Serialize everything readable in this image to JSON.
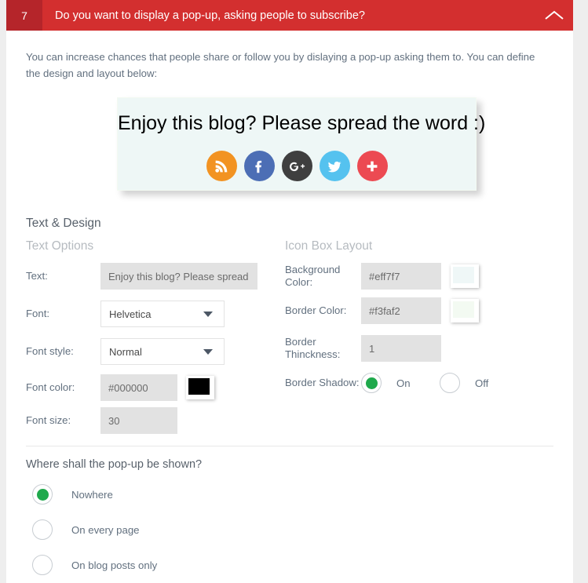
{
  "panel": {
    "number": "7",
    "title": "Do you want to display a pop-up, asking people to subscribe?",
    "collapse_icon": "chevron-up-icon",
    "header_bg": "#d32f2f",
    "number_bg": "#b5252a",
    "intro": "You can increase chances that people share or follow you by dislaying a pop-up asking them to. You can define the design and layout below:"
  },
  "preview": {
    "text": "Enjoy this blog? Please spread the word :)",
    "background_color": "#eff7f7",
    "border_color": "#f3faf2",
    "font_color": "#000000",
    "font_size": "30",
    "icons": [
      {
        "name": "rss-icon",
        "color": "#f29322"
      },
      {
        "name": "facebook-icon",
        "color": "#4c6eb5"
      },
      {
        "name": "google-plus-icon",
        "color": "#3f3f3f"
      },
      {
        "name": "twitter-icon",
        "color": "#55c2ef"
      },
      {
        "name": "share-plus-icon",
        "color": "#ec4a52"
      }
    ]
  },
  "design": {
    "section_title": "Text & Design",
    "text_options": {
      "title": "Text Options",
      "text_label": "Text:",
      "text_value": "Enjoy this blog? Please spread the word :)",
      "font_label": "Font:",
      "font_value": "Helvetica",
      "font_style_label": "Font style:",
      "font_style_value": "Normal",
      "font_color_label": "Font color:",
      "font_color_value": "#000000",
      "font_size_label": "Font size:",
      "font_size_value": "30"
    },
    "icon_box_layout": {
      "title": "Icon Box Layout",
      "background_color_label": "Background Color:",
      "background_color_value": "#eff7f7",
      "border_color_label": "Border Color:",
      "border_color_value": "#f3faf2",
      "border_thickness_label": "Border Thinckness:",
      "border_thickness_value": "1",
      "border_shadow_label": "Border Shadow:",
      "border_shadow_on_label": "On",
      "border_shadow_off_label": "Off",
      "border_shadow_selected": "On"
    }
  },
  "placement": {
    "question": "Where shall the pop-up be shown?",
    "options": [
      {
        "label": "Nowhere",
        "selected": true
      },
      {
        "label": "On every page",
        "selected": false
      },
      {
        "label": "On blog posts only",
        "selected": false
      }
    ]
  },
  "colors": {
    "accent_green": "#1fa94c",
    "header_red": "#d32f2f",
    "label_text": "#62707f"
  }
}
